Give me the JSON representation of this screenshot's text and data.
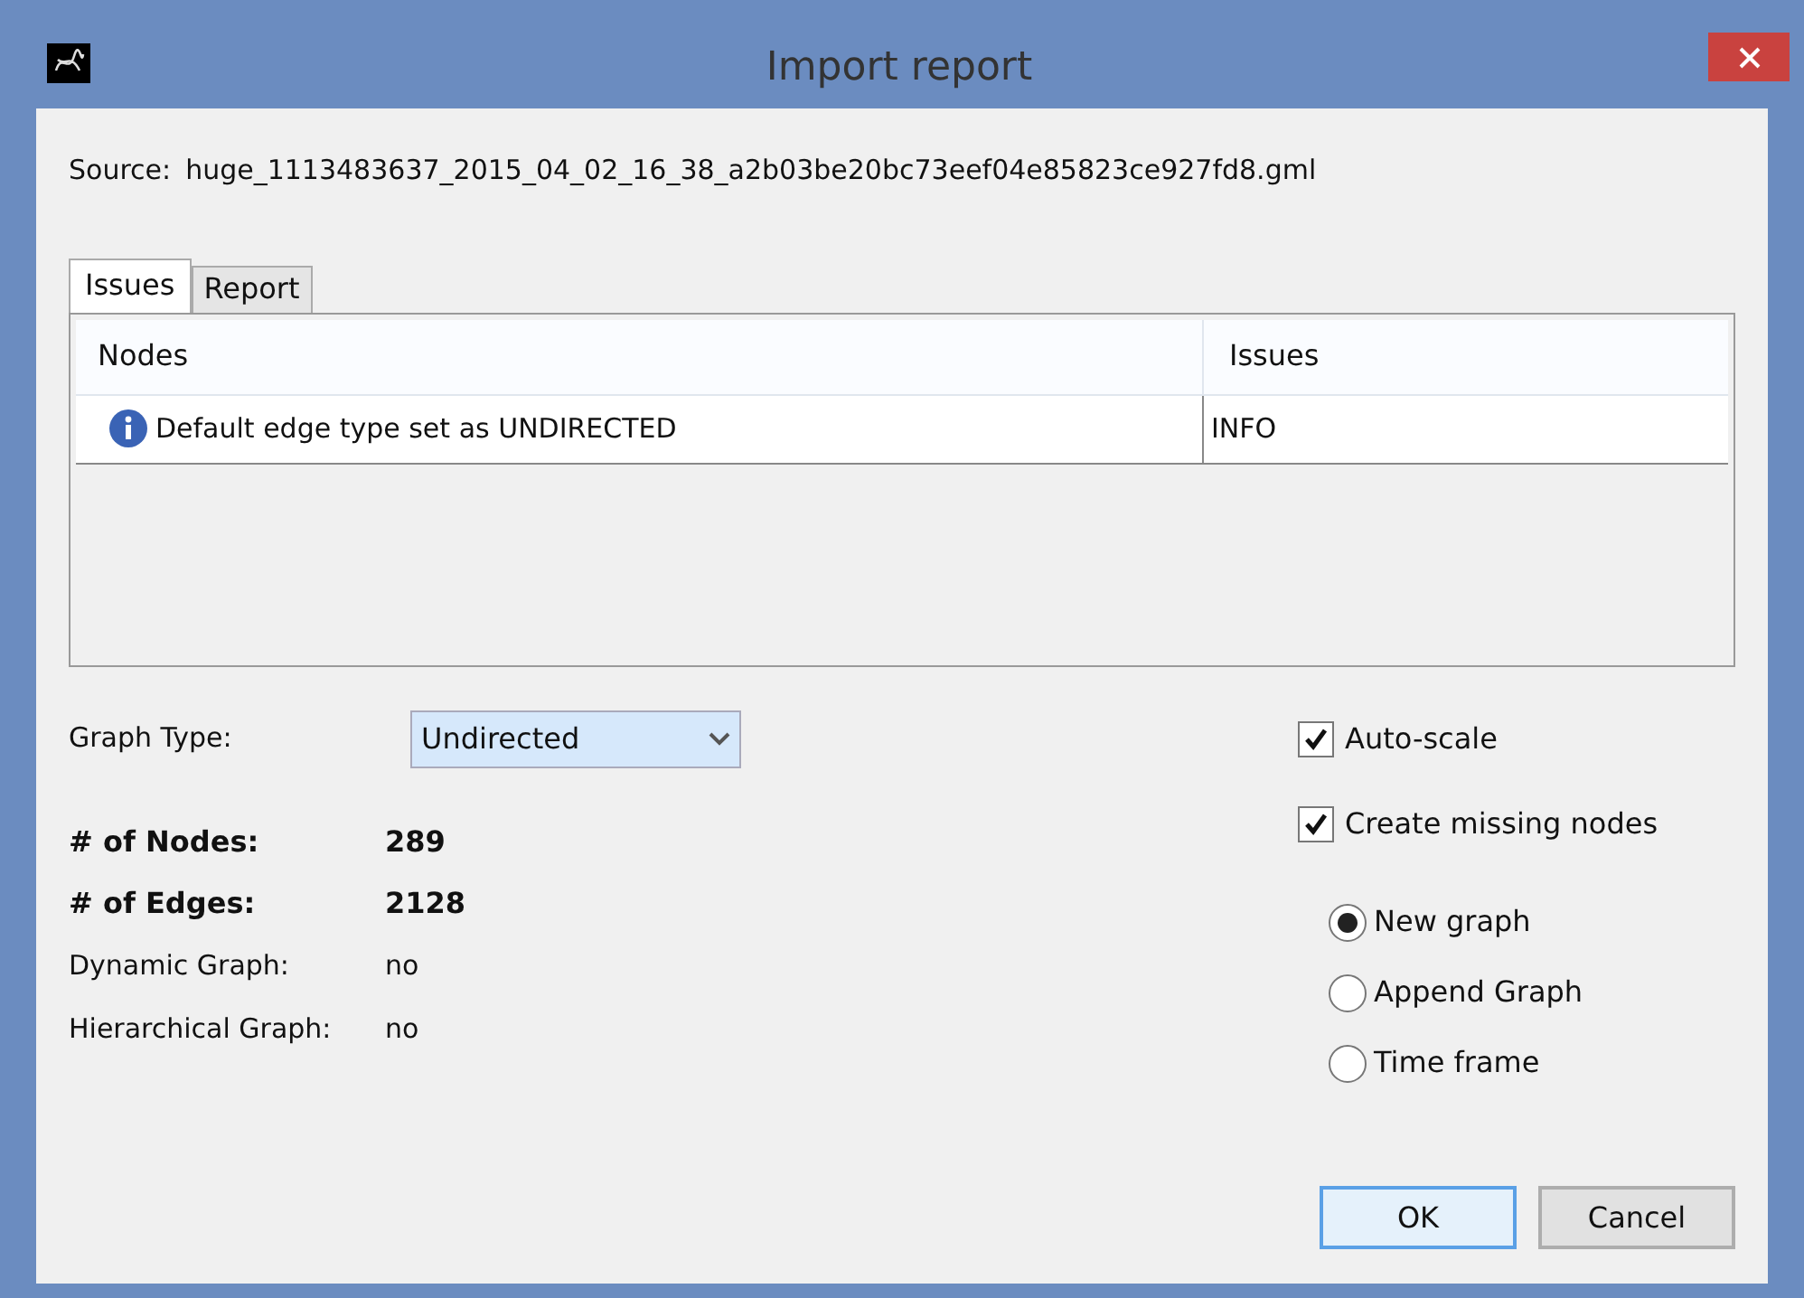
{
  "window": {
    "title": "Import report"
  },
  "source": {
    "label": "Source:",
    "value": "huge_1113483637_2015_04_02_16_38_a2b03be20bc73eef04e85823ce927fd8.gml"
  },
  "tabs": [
    {
      "label": "Issues",
      "selected": true
    },
    {
      "label": "Report",
      "selected": false
    }
  ],
  "table": {
    "columns": [
      "Nodes",
      "Issues"
    ],
    "rows": [
      {
        "message": "Default edge type set as UNDIRECTED",
        "level": "INFO",
        "selected": false
      }
    ]
  },
  "graph_type": {
    "label": "Graph Type:",
    "value": "Undirected"
  },
  "stats": [
    {
      "label": "# of Nodes:",
      "value": "289",
      "bold": true
    },
    {
      "label": "# of Edges:",
      "value": "2128",
      "bold": true
    },
    {
      "label": "Dynamic Graph:",
      "value": "no",
      "bold": false
    },
    {
      "label": "Hierarchical Graph:",
      "value": "no",
      "bold": false
    }
  ],
  "checkboxes": [
    {
      "label": "Auto-scale",
      "checked": true
    },
    {
      "label": "Create missing nodes",
      "checked": true
    }
  ],
  "radios": [
    {
      "label": "New graph",
      "selected": true
    },
    {
      "label": "Append Graph",
      "selected": false
    },
    {
      "label": "Time frame",
      "selected": false
    }
  ],
  "buttons": [
    {
      "label": "OK",
      "default": true
    },
    {
      "label": "Cancel",
      "default": false
    }
  ]
}
